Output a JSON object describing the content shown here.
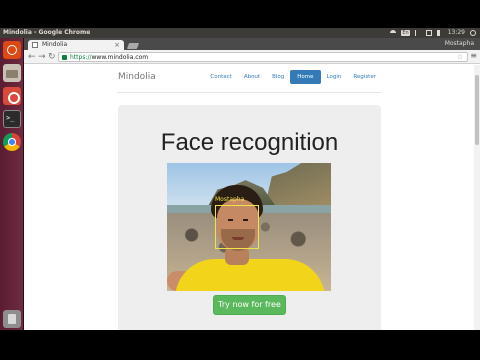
{
  "os": {
    "window_title": "Mindolia - Google Chrome",
    "keyboard_layout": "En",
    "clock": "13:29",
    "launcher_apps": [
      "ubuntu-dash-icon",
      "files-icon",
      "settings-icon",
      "terminal-icon",
      "chrome-icon",
      "trash-icon"
    ]
  },
  "browser": {
    "tab_title": "Mindolia",
    "profile_name": "Mostapha",
    "url_scheme": "https://",
    "url_host": "www.mindolia.com"
  },
  "site": {
    "brand": "Mindolia",
    "nav": [
      {
        "label": "Contact"
      },
      {
        "label": "About"
      },
      {
        "label": "Blog"
      },
      {
        "label": "Home",
        "active": true
      },
      {
        "label": "Login"
      },
      {
        "label": "Register"
      }
    ],
    "hero": {
      "title": "Face recognition",
      "detected_name": "Mostapha",
      "cta_label": "Try now for free"
    }
  },
  "colors": {
    "launcher": "#6e2a40",
    "nav_active": "#337ab7",
    "cta": "#5cb85c",
    "face_box": "#f0e44a"
  }
}
